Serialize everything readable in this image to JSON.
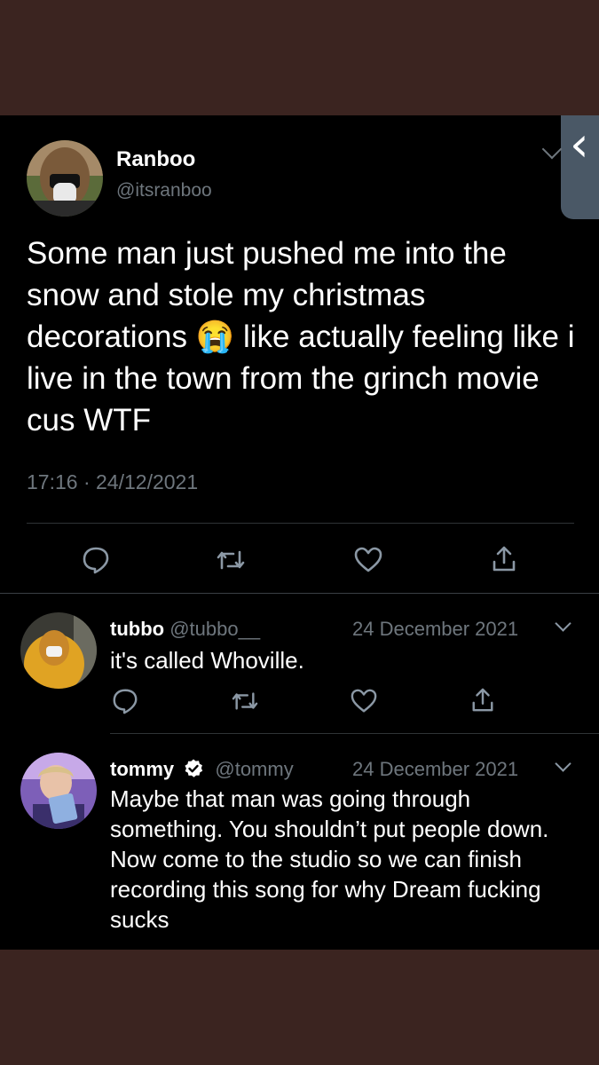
{
  "tweet": {
    "name": "Ranboo",
    "handle": "@itsranboo",
    "text_before_emoji": "Some man just pushed me into the snow and stole my christmas decorations",
    "emoji": "😭",
    "text_after_emoji": " like actually feeling like i live in the town from the grinch movie cus WTF",
    "time": "17:16",
    "separator": "·",
    "date": "24/12/2021"
  },
  "replies": [
    {
      "name": "tubbo",
      "handle": "@tubbo__",
      "date": "24 December 2021",
      "text": "it's called Whoville.",
      "verified": false
    },
    {
      "name": "tommy",
      "handle": "@tommy",
      "date": "24 December 2021",
      "text": "Maybe that man was going through something. You shouldn’t put people down. Now come to the studio so we can finish recording this song for why Dream fucking sucks",
      "verified": true
    }
  ],
  "colors": {
    "background": "#000000",
    "border": "#3b2420",
    "muted_text": "#6e767d",
    "icon": "#8b98a5"
  },
  "icons": [
    "reply-icon",
    "retweet-icon",
    "like-icon",
    "share-icon",
    "chevron-down-icon",
    "verified-badge-icon"
  ]
}
